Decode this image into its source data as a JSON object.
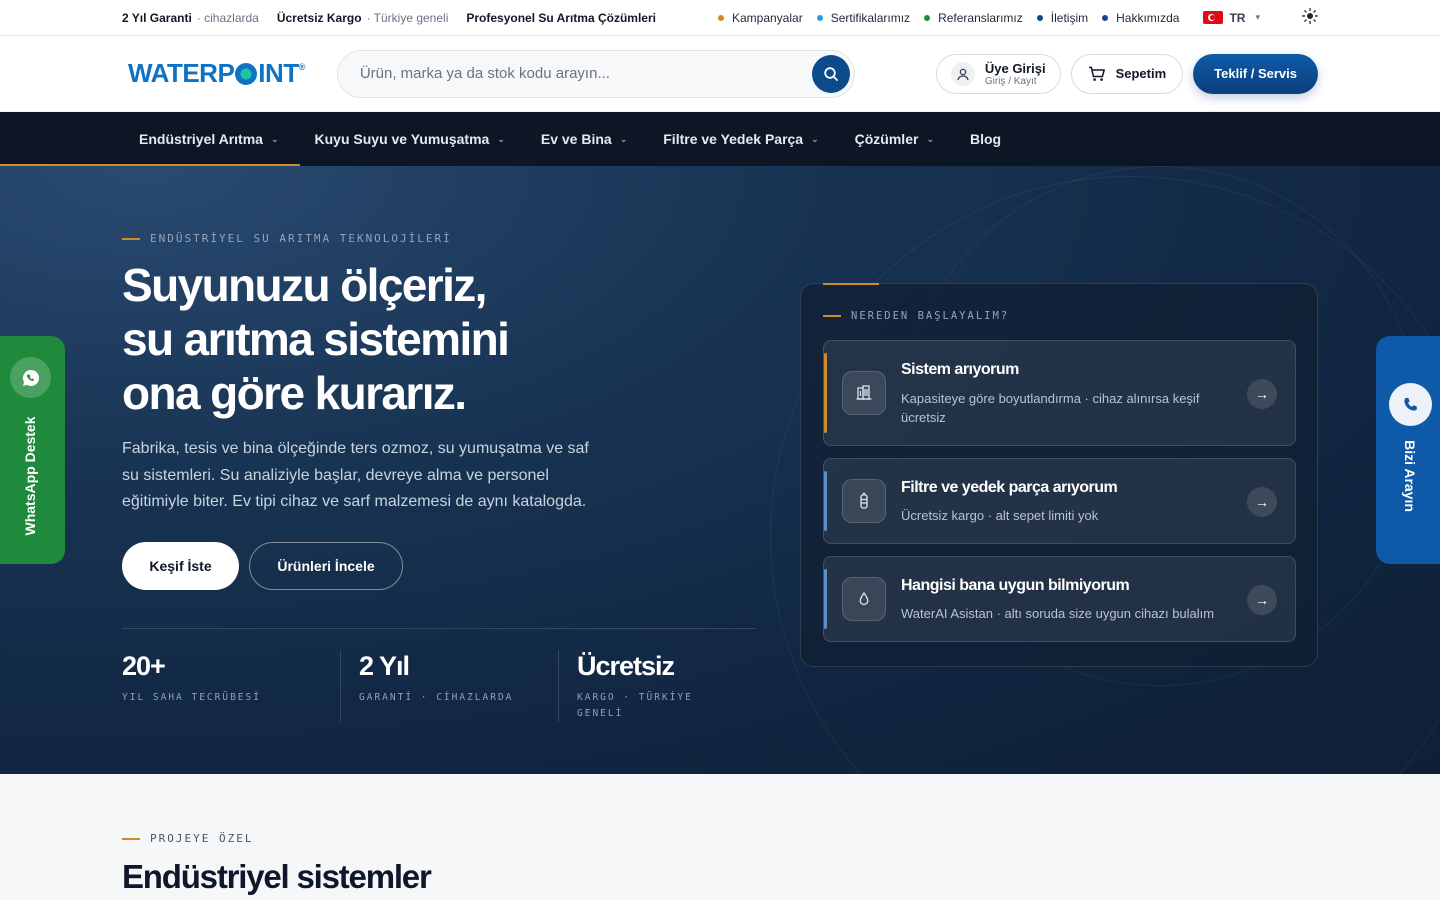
{
  "topbar": {
    "items": [
      {
        "bold": "2 Yıl Garanti",
        "muted": "· cihazlarda"
      },
      {
        "bold": "Ücretsiz Kargo",
        "muted": "· Türkiye geneli"
      },
      {
        "bold": "Profesyonel Su Arıtma Çözümleri",
        "muted": ""
      }
    ],
    "links": [
      {
        "label": "Kampanyalar",
        "color": "#d08a2a"
      },
      {
        "label": "Sertifikalarımız",
        "color": "#1ea3d8"
      },
      {
        "label": "Referanslarımız",
        "color": "#1f8a3b"
      },
      {
        "label": "İletişim",
        "color": "#0c4a8c"
      },
      {
        "label": "Hakkımızda",
        "color": "#0c4a8c"
      }
    ],
    "lang": "TR"
  },
  "header": {
    "logo_part1": "WATERP",
    "logo_part2": "INT",
    "search_placeholder": "Ürün, marka ya da stok kodu arayın...",
    "login_title": "Üye Girişi",
    "login_sub": "Giriş / Kayıt",
    "cart_label": "Sepetim",
    "cta_label": "Teklif / Servis"
  },
  "nav": {
    "items": [
      {
        "label": "Endüstriyel Arıtma",
        "has_dropdown": true
      },
      {
        "label": "Kuyu Suyu ve Yumuşatma",
        "has_dropdown": true
      },
      {
        "label": "Ev ve Bina",
        "has_dropdown": true
      },
      {
        "label": "Filtre ve Yedek Parça",
        "has_dropdown": true
      },
      {
        "label": "Çözümler",
        "has_dropdown": true
      },
      {
        "label": "Blog",
        "has_dropdown": false
      }
    ]
  },
  "hero": {
    "eyebrow": "ENDÜSTRİYEL SU ARITMA TEKNOLOJİLERİ",
    "title_lines": [
      "Suyunuzu ölçeriz,",
      "su arıtma sistemini",
      "ona göre kurarız."
    ],
    "lede": "Fabrika, tesis ve bina ölçeğinde ters ozmoz, su yumuşatma ve saf su sistemleri. Su analiziyle başlar, devreye alma ve personel eğitimiyle biter. Ev tipi cihaz ve sarf malzemesi de aynı katalogda.",
    "primary_btn": "Keşif İste",
    "secondary_btn": "Ürünleri İncele",
    "stats": [
      {
        "value": "20+",
        "label": "YIL SAHA TECRÜBESİ"
      },
      {
        "value": "2 Yıl",
        "label": "GARANTİ · CİHAZLARDA"
      },
      {
        "value": "Ücretsiz",
        "label": "KARGO · TÜRKİYE GENELİ"
      }
    ]
  },
  "panel": {
    "eyebrow": "NEREDEN BAŞLAYALIM?",
    "options": [
      {
        "title": "Sistem arıyorum",
        "subtitle": "Kapasiteye göre boyutlandırma · cihaz alınırsa keşif ücretsiz",
        "icon": "building-icon",
        "accent": "#d08a2a"
      },
      {
        "title": "Filtre ve yedek parça arıyorum",
        "subtitle": "Ücretsiz kargo · alt sepet limiti yok",
        "icon": "filter-cartridge-icon",
        "accent": "#5a8fc8"
      },
      {
        "title": "Hangisi bana uygun bilmiyorum",
        "subtitle": "WaterAI Asistan · altı soruda size uygun cihazı bulalım",
        "icon": "water-drop-icon",
        "accent": "#5a8fc8"
      }
    ]
  },
  "side": {
    "whatsapp_label": "WhatsApp Destek",
    "call_label": "Bizi Arayın"
  },
  "section": {
    "eyebrow": "PROJEYE ÖZEL",
    "title": "Endüstriyel sistemler"
  },
  "colors": {
    "brand_blue": "#0c4a8c",
    "accent_orange": "#d08a2a",
    "whatsapp_green": "#1f8a3b",
    "nav_dark": "#0c1624"
  }
}
